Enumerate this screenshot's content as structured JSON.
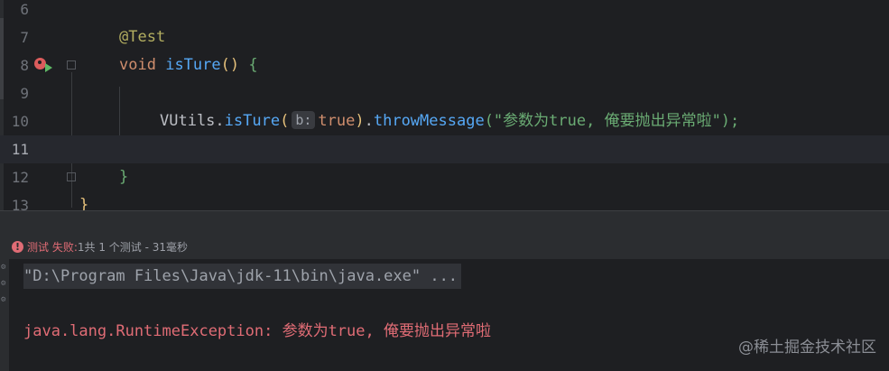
{
  "editor": {
    "lines": [
      {
        "num": "6"
      },
      {
        "num": "7",
        "annotation": "@Test"
      },
      {
        "num": "8",
        "kw": "void",
        "fn": "isTure",
        "parens": "()",
        "brace": "{"
      },
      {
        "num": "9"
      },
      {
        "num": "10",
        "cls": "VUtils",
        "dot": ".",
        "fn": "isTure",
        "open": "(",
        "hint": "b:",
        "kw": "true",
        "close": ")",
        "dot2": ".",
        "fn2": "throwMessage",
        "str": "(\"参数为true, 俺要抛出异常啦\");"
      },
      {
        "num": "11"
      },
      {
        "num": "12",
        "brace": "}"
      },
      {
        "num": "13",
        "brace": "}"
      }
    ]
  },
  "test_status": {
    "icon": "error-icon",
    "label_prefix": "测试 ",
    "fail": "失败:",
    "count": "1共 1 个测试",
    "separator": " - ",
    "duration": "31毫秒"
  },
  "console": {
    "command": "\"D:\\Program Files\\Java\\jdk-11\\bin\\java.exe\" ...",
    "exception": "java.lang.RuntimeException: 参数为true, 俺要抛出异常啦"
  },
  "watermark": "@稀土掘金技术社区",
  "colors": {
    "background": "#1e1f22",
    "error": "#e06c75",
    "keyword": "#cf8e6d",
    "function": "#56a8f5",
    "string": "#6aab73"
  }
}
